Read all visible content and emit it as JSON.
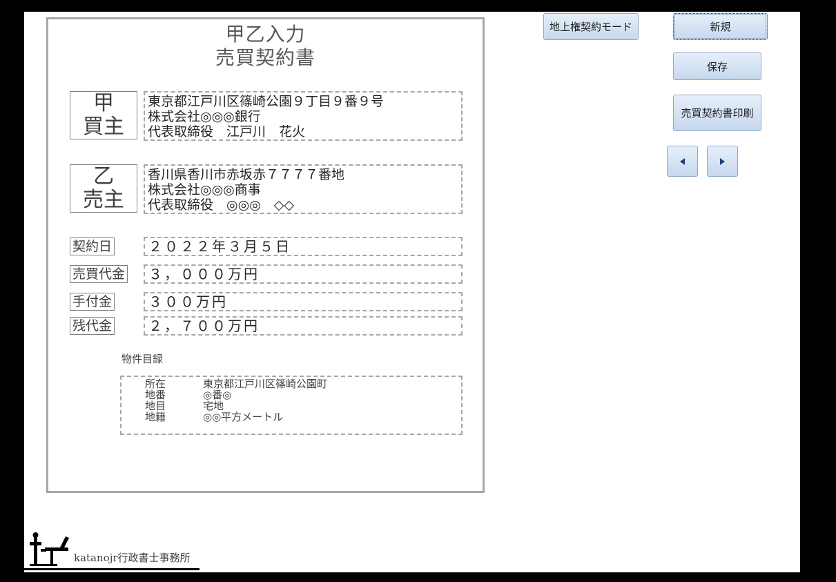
{
  "form": {
    "title_line1": "甲乙入力",
    "title_line2": "売買契約書",
    "buyer": {
      "label_top": "甲",
      "label_bottom": "買主",
      "address": "東京都江戸川区篠崎公園９丁目９番９号",
      "company": "株式会社◎◎◎銀行",
      "representative": "代表取締役　江戸川　花火"
    },
    "seller": {
      "label_top": "乙",
      "label_bottom": "売主",
      "address": "香川県香川市赤坂赤７７７７番地",
      "company": "株式会社◎◎◎商事",
      "representative": "代表取締役　◎◎◎　◇◇"
    },
    "fields": {
      "contract_date_label": "契約日",
      "contract_date_value": "２０２２年３月５日",
      "sale_price_label": "売買代金",
      "sale_price_value": "３，０００万円",
      "deposit_label": "手付金",
      "deposit_value": "３００万円",
      "balance_label": "残代金",
      "balance_value": "２，７００万円"
    },
    "property": {
      "heading": "物件目録",
      "rows": [
        {
          "key": "所在",
          "value": "東京都江戸川区篠崎公園町"
        },
        {
          "key": "地番",
          "value": "◎番◎"
        },
        {
          "key": "地目",
          "value": "宅地"
        },
        {
          "key": "地籍",
          "value": "◎◎平方メートル"
        }
      ]
    }
  },
  "buttons": {
    "surface_rights_mode": "地上権契約モード",
    "new": "新規",
    "save": "保存",
    "print_contract": "売買契約書印刷"
  },
  "icons": {
    "prev": "triangle-left-icon",
    "next": "triangle-right-icon",
    "logo": "katanojr-logo-icon"
  },
  "footer": {
    "office_name": "katanojr行政書士事務所"
  },
  "colors": {
    "button_top": "#e6effa",
    "button_bottom": "#c7d8ee",
    "button_border": "#8ea9c9",
    "arrow": "#1f3f7a",
    "sheet_border": "#a6a6a6"
  }
}
